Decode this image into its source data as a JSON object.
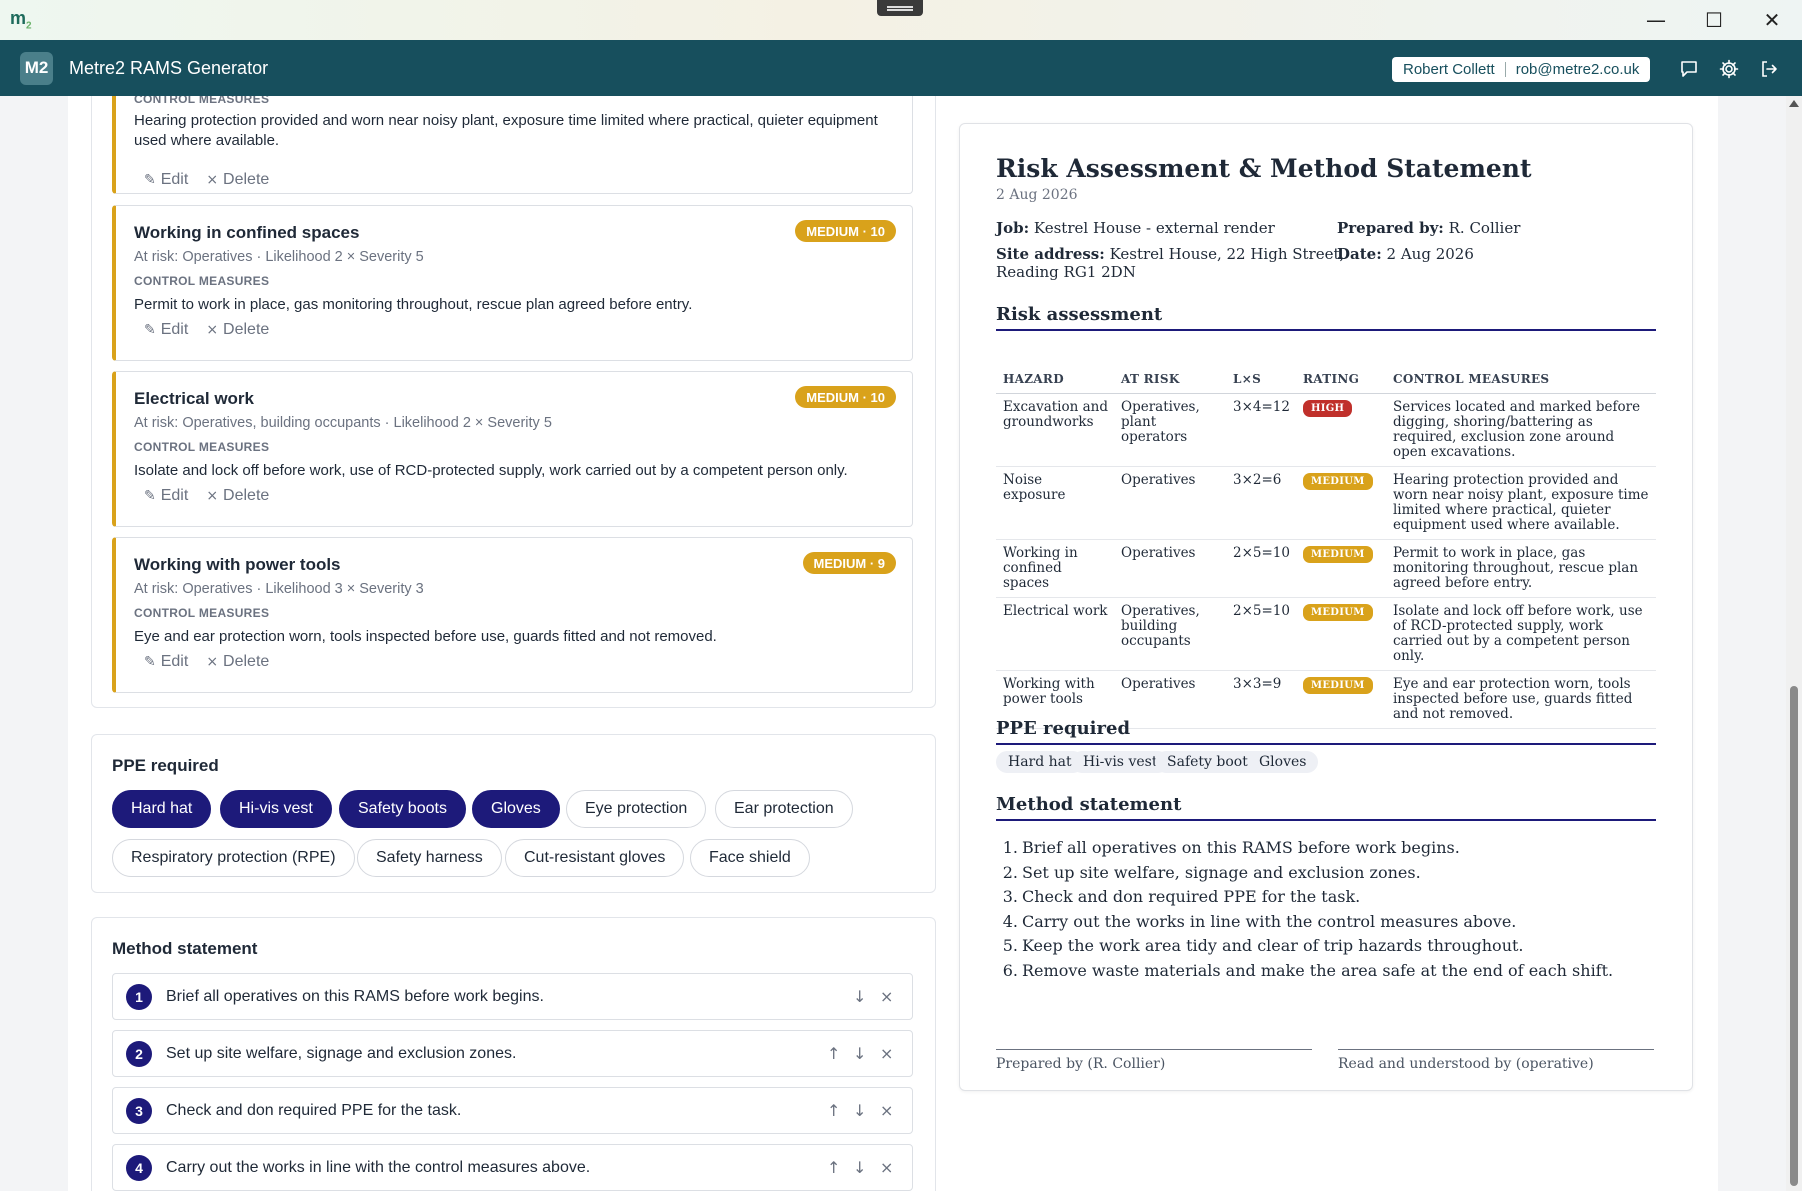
{
  "window": {
    "logo": "m",
    "logo_sub": "2",
    "min": "—",
    "max": "☐",
    "close": "✕"
  },
  "app": {
    "badge": "M2",
    "title": "Metre2 RAMS Generator",
    "user_name": "Robert Collett",
    "user_email": "rob@metre2.co.uk"
  },
  "hazards": [
    {
      "title": "",
      "badge": "",
      "meta": "",
      "cm_label": "CONTROL MEASURES",
      "cm_text": "Hearing protection provided and worn near noisy plant, exposure time limited where practical, quieter equipment used where available."
    },
    {
      "title": "Working in confined spaces",
      "badge": "MEDIUM · 10",
      "meta": "At risk: Operatives · Likelihood 2 × Severity 5",
      "cm_label": "CONTROL MEASURES",
      "cm_text": "Permit to work in place, gas monitoring throughout, rescue plan agreed before entry."
    },
    {
      "title": "Electrical work",
      "badge": "MEDIUM · 10",
      "meta": "At risk: Operatives, building occupants · Likelihood 2 × Severity 5",
      "cm_label": "CONTROL MEASURES",
      "cm_text": "Isolate and lock off before work, use of RCD-protected supply, work carried out by a competent person only."
    },
    {
      "title": "Working with power tools",
      "badge": "MEDIUM · 9",
      "meta": "At risk: Operatives · Likelihood 3 × Severity 3",
      "cm_label": "CONTROL MEASURES",
      "cm_text": "Eye and ear protection worn, tools inspected before use, guards fitted and not removed."
    }
  ],
  "actions": {
    "edit": "Edit",
    "delete": "Delete",
    "edit_icon": "✎",
    "delete_icon": "×"
  },
  "ppe": {
    "heading": "PPE required",
    "items": [
      {
        "label": "Hard hat",
        "selected": true
      },
      {
        "label": "Hi-vis vest",
        "selected": true
      },
      {
        "label": "Safety boots",
        "selected": true
      },
      {
        "label": "Gloves",
        "selected": true
      },
      {
        "label": "Eye protection",
        "selected": false
      },
      {
        "label": "Ear protection",
        "selected": false
      },
      {
        "label": "Respiratory protection (RPE)",
        "selected": false
      },
      {
        "label": "Safety harness",
        "selected": false
      },
      {
        "label": "Cut-resistant gloves",
        "selected": false
      },
      {
        "label": "Face shield",
        "selected": false
      }
    ]
  },
  "method": {
    "heading": "Method statement",
    "steps": [
      {
        "n": "1",
        "text": "Brief all operatives on this RAMS before work begins."
      },
      {
        "n": "2",
        "text": "Set up site welfare, signage and exclusion zones."
      },
      {
        "n": "3",
        "text": "Check and don required PPE for the task."
      },
      {
        "n": "4",
        "text": "Carry out the works in line with the control measures above."
      }
    ],
    "up": "↑",
    "down": "↓",
    "remove": "×"
  },
  "doc": {
    "title": "Risk Assessment & Method Statement",
    "date": "2 Aug 2026",
    "job_label": "Job:",
    "job": "Kestrel House - external render",
    "site_label": "Site address:",
    "site_line1": "Kestrel House, 22 High Street,",
    "site_line2": "Reading RG1 2DN",
    "prepared_label": "Prepared by:",
    "prepared": "R. Collier",
    "date_label": "Date:",
    "date_value": "2 Aug 2026",
    "ra_heading": "Risk assessment",
    "cols": {
      "hazard": "HAZARD",
      "at_risk": "AT RISK",
      "lxs": "L×S",
      "rating": "RATING",
      "cm": "CONTROL MEASURES"
    },
    "rows": [
      {
        "hazard": "Excavation and groundworks",
        "at_risk": "Operatives, plant operators",
        "lxs": "3×4=12",
        "rating": "HIGH",
        "cm": "Services located and marked before digging, shoring/battering as required, exclusion zone around open excavations."
      },
      {
        "hazard": "Noise exposure",
        "at_risk": "Operatives",
        "lxs": "3×2=6",
        "rating": "MEDIUM",
        "cm": "Hearing protection provided and worn near noisy plant, exposure time limited where practical, quieter equipment used where available."
      },
      {
        "hazard": "Working in confined spaces",
        "at_risk": "Operatives",
        "lxs": "2×5=10",
        "rating": "MEDIUM",
        "cm": "Permit to work in place, gas monitoring throughout, rescue plan agreed before entry."
      },
      {
        "hazard": "Electrical work",
        "at_risk": "Operatives, building occupants",
        "lxs": "2×5=10",
        "rating": "MEDIUM",
        "cm": "Isolate and lock off before work, use of RCD-protected supply, work carried out by a competent person only."
      },
      {
        "hazard": "Working with power tools",
        "at_risk": "Operatives",
        "lxs": "3×3=9",
        "rating": "MEDIUM",
        "cm": "Eye and ear protection worn, tools inspected before use, guards fitted and not removed."
      }
    ],
    "ppe_heading": "PPE required",
    "ppe_tags": [
      "Hard hat",
      "Hi-vis vest",
      "Safety boots",
      "Gloves"
    ],
    "ms_heading": "Method statement",
    "ms_steps": [
      "Brief all operatives on this RAMS before work begins.",
      "Set up site welfare, signage and exclusion zones.",
      "Check and don required PPE for the task.",
      "Carry out the works in line with the control measures above.",
      "Keep the work area tidy and clear of trip hazards throughout.",
      "Remove waste materials and make the area safe at the end of each shift."
    ],
    "sig_prepared": "Prepared by (R. Collier)",
    "sig_read": "Read and understood by (operative)"
  }
}
